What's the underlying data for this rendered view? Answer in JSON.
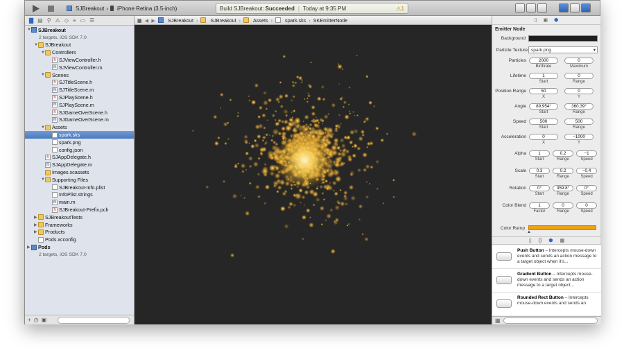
{
  "toolbar": {
    "scheme": "SJBreakout",
    "sep": "›",
    "device": "iPhone Retina (3.5-inch)",
    "status_prefix": "Build SJBreakout: ",
    "status_result": "Succeeded",
    "status_sep": "|",
    "status_time": "Today at 9:35 PM",
    "warning_count": "1"
  },
  "navigator": {
    "items": [
      {
        "label": "SJBreakout",
        "depth": 0,
        "icon": "project",
        "tri": "▼",
        "bold": true
      },
      {
        "label": "2 targets, iOS SDK 7.0",
        "depth": 0,
        "icon": "",
        "tri": "",
        "sub": true
      },
      {
        "label": "SJBreakout",
        "depth": 1,
        "icon": "folder",
        "tri": "▼"
      },
      {
        "label": "Controllers",
        "depth": 2,
        "icon": "folder",
        "tri": "▼"
      },
      {
        "label": "SJViewController.h",
        "depth": 3,
        "icon": "h",
        "tri": ""
      },
      {
        "label": "SJViewController.m",
        "depth": 3,
        "icon": "m",
        "tri": ""
      },
      {
        "label": "Scenes",
        "depth": 2,
        "icon": "folder",
        "tri": "▼"
      },
      {
        "label": "SJTitleScene.h",
        "depth": 3,
        "icon": "h",
        "tri": ""
      },
      {
        "label": "SJTitleScene.m",
        "depth": 3,
        "icon": "m",
        "tri": ""
      },
      {
        "label": "SJPlayScene.h",
        "depth": 3,
        "icon": "h",
        "tri": ""
      },
      {
        "label": "SJPlayScene.m",
        "depth": 3,
        "icon": "m",
        "tri": ""
      },
      {
        "label": "SJGameOverScene.h",
        "depth": 3,
        "icon": "h",
        "tri": ""
      },
      {
        "label": "SJGameOverScene.m",
        "depth": 3,
        "icon": "m",
        "tri": ""
      },
      {
        "label": "Assets",
        "depth": 2,
        "icon": "folder",
        "tri": "▼"
      },
      {
        "label": "spark.sks",
        "depth": 3,
        "icon": "file",
        "tri": "",
        "selected": true
      },
      {
        "label": "spark.png",
        "depth": 3,
        "icon": "file",
        "tri": ""
      },
      {
        "label": "config.json",
        "depth": 3,
        "icon": "file",
        "tri": ""
      },
      {
        "label": "SJAppDelegate.h",
        "depth": 2,
        "icon": "h",
        "tri": ""
      },
      {
        "label": "SJAppDelegate.m",
        "depth": 2,
        "icon": "m",
        "tri": ""
      },
      {
        "label": "Images.xcassets",
        "depth": 2,
        "icon": "folder",
        "tri": ""
      },
      {
        "label": "Supporting Files",
        "depth": 2,
        "icon": "folder",
        "tri": "▼"
      },
      {
        "label": "SJBreakout-Info.plist",
        "depth": 3,
        "icon": "file",
        "tri": ""
      },
      {
        "label": "InfoPlist.strings",
        "depth": 3,
        "icon": "file",
        "tri": ""
      },
      {
        "label": "main.m",
        "depth": 3,
        "icon": "m",
        "tri": ""
      },
      {
        "label": "SJBreakout-Prefix.pch",
        "depth": 3,
        "icon": "h",
        "tri": ""
      },
      {
        "label": "SJBreakoutTests",
        "depth": 1,
        "icon": "folder",
        "tri": "▶"
      },
      {
        "label": "Frameworks",
        "depth": 1,
        "icon": "folder",
        "tri": "▶"
      },
      {
        "label": "Products",
        "depth": 1,
        "icon": "folder",
        "tri": "▶"
      },
      {
        "label": "Pods.xcconfig",
        "depth": 1,
        "icon": "file",
        "tri": ""
      },
      {
        "label": "Pods",
        "depth": 0,
        "icon": "project",
        "tri": "▶",
        "bold": true
      },
      {
        "label": "2 targets, iOS SDK 7.0",
        "depth": 0,
        "icon": "",
        "tri": "",
        "sub": true
      }
    ]
  },
  "jumpbar": {
    "crumbs": [
      "SJBreakout",
      "SJBreakout",
      "Assets",
      "spark.sks",
      "SKEmitterNode"
    ],
    "sep": "›"
  },
  "inspector": {
    "title": "Emitter Node",
    "background_label": "Background",
    "texture_label": "Particle Texture",
    "texture_value": "spark.png",
    "rows": [
      {
        "label": "Particles",
        "a": "2000",
        "b": "0",
        "ca": "Birthrate",
        "cb": "Maximum"
      },
      {
        "label": "Lifetime",
        "a": "1",
        "b": "0",
        "ca": "Start",
        "cb": "Range"
      },
      {
        "label": "Position Range",
        "a": "50",
        "b": "0",
        "ca": "X",
        "cb": "Y"
      },
      {
        "label": "Angle",
        "a": "89.954°",
        "b": "360.39°",
        "ca": "Start",
        "cb": "Range"
      },
      {
        "label": "Speed",
        "a": "500",
        "b": "500",
        "ca": "Start",
        "cb": "Range"
      },
      {
        "label": "Acceleration",
        "a": "0",
        "b": "−1000",
        "ca": "X",
        "cb": "Y"
      }
    ],
    "rows3": [
      {
        "label": "Alpha",
        "a": "1",
        "b": "0.2",
        "c": "−1",
        "ca": "Start",
        "cb": "Range",
        "cc": "Speed"
      },
      {
        "label": "Scale",
        "a": "0.3",
        "b": "0.2",
        "c": "−0.4",
        "ca": "Start",
        "cb": "Range",
        "cc": "Speed"
      },
      {
        "label": "Rotation",
        "a": "0°",
        "b": "359.8°",
        "c": "0°",
        "ca": "Start",
        "cb": "Range",
        "cc": "Speed"
      },
      {
        "label": "Color Blend",
        "a": "1",
        "b": "0",
        "c": "0",
        "ca": "Factor",
        "cb": "Range",
        "cc": "Speed"
      }
    ],
    "ramp_label": "Color Ramp",
    "ramp_color": "#f0a30f"
  },
  "library": {
    "items": [
      {
        "name": "Push Button",
        "desc": " – Intercepts mouse-down events and sends an action message to a target object when it's..."
      },
      {
        "name": "Gradient Button",
        "desc": " – Intercepts mouse-down events and sends an action message to a target object..."
      },
      {
        "name": "Rounded Rect Button",
        "desc": " – Intercepts mouse-down events and sends an"
      }
    ]
  }
}
